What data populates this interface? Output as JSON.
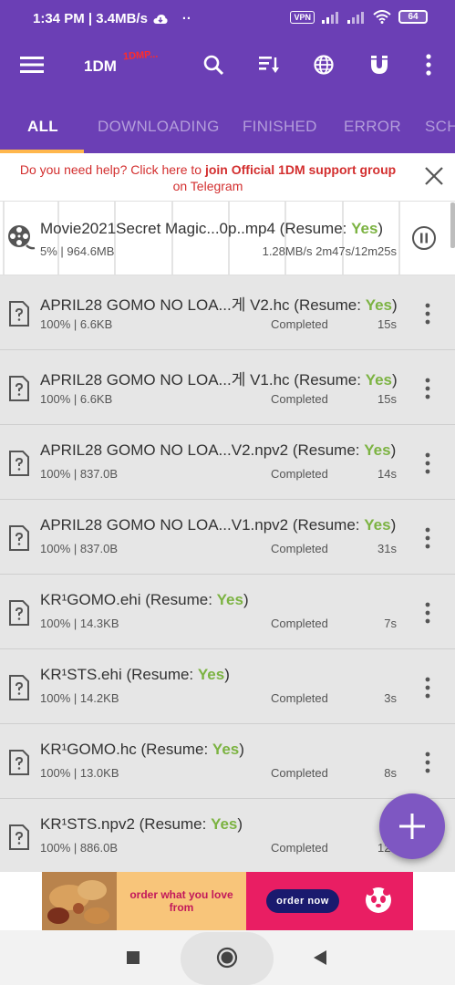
{
  "status_bar": {
    "time_speed": "1:34 PM | 3.4MB/s",
    "dots": "··",
    "vpn": "VPN",
    "battery": "64"
  },
  "toolbar": {
    "app_title": "1DM",
    "app_badge": "1DMP...",
    "icons": [
      "menu-icon",
      "search-icon",
      "sort-icon",
      "browser-icon",
      "magnet-icon",
      "more-vert-icon"
    ]
  },
  "tabs": [
    {
      "label": "ALL",
      "active": true
    },
    {
      "label": "DOWNLOADING",
      "active": false
    },
    {
      "label": "FINISHED",
      "active": false
    },
    {
      "label": "ERROR",
      "active": false
    },
    {
      "label": "SCH",
      "active": false
    }
  ],
  "help_banner": {
    "prefix": "Do you need help? Click here to ",
    "bold": "join Official 1DM support group",
    "suffix": "on Telegram"
  },
  "active_download": {
    "name": "Movie2021Secret Magic...0p..mp4 (Resume: ",
    "resume": "Yes",
    "name_close": ")",
    "progress": "5% | 964.6MB",
    "speed": "1.28MB/s  2m47s/12m25s"
  },
  "items": [
    {
      "name": "APRIL28 GOMO NO LOA...게 V2.hc (Resume: ",
      "resume": "Yes",
      "close": ")",
      "size": "100% | 6.6KB",
      "status": "Completed",
      "time": "15s"
    },
    {
      "name": "APRIL28 GOMO NO LOA...게 V1.hc (Resume: ",
      "resume": "Yes",
      "close": ")",
      "size": "100% | 6.6KB",
      "status": "Completed",
      "time": "15s"
    },
    {
      "name": "APRIL28 GOMO NO LOA...V2.npv2 (Resume: ",
      "resume": "Yes",
      "close": ")",
      "size": "100% | 837.0B",
      "status": "Completed",
      "time": "14s"
    },
    {
      "name": "APRIL28 GOMO NO LOA...V1.npv2 (Resume: ",
      "resume": "Yes",
      "close": ")",
      "size": "100% | 837.0B",
      "status": "Completed",
      "time": "31s"
    },
    {
      "name": "KR¹GOMO.ehi (Resume: ",
      "resume": "Yes",
      "close": ")",
      "size": "100% | 14.3KB",
      "status": "Completed",
      "time": "7s"
    },
    {
      "name": "KR¹STS.ehi (Resume: ",
      "resume": "Yes",
      "close": ")",
      "size": "100% | 14.2KB",
      "status": "Completed",
      "time": "3s"
    },
    {
      "name": "KR¹GOMO.hc (Resume: ",
      "resume": "Yes",
      "close": ")",
      "size": "100% | 13.0KB",
      "status": "Completed",
      "time": "8s"
    },
    {
      "name": "KR¹STS.npv2 (Resume: ",
      "resume": "Yes",
      "close": ")",
      "size": "100% | 886.0B",
      "status": "Completed",
      "time": "12s"
    }
  ],
  "ad": {
    "tagline": "order what you love from",
    "button": "order now"
  },
  "colors": {
    "brand": "#6b3fb5",
    "accent": "#ffb74d",
    "fab": "#7e57c2",
    "resume_yes": "#7cb342",
    "help_text": "#d32f2f"
  }
}
